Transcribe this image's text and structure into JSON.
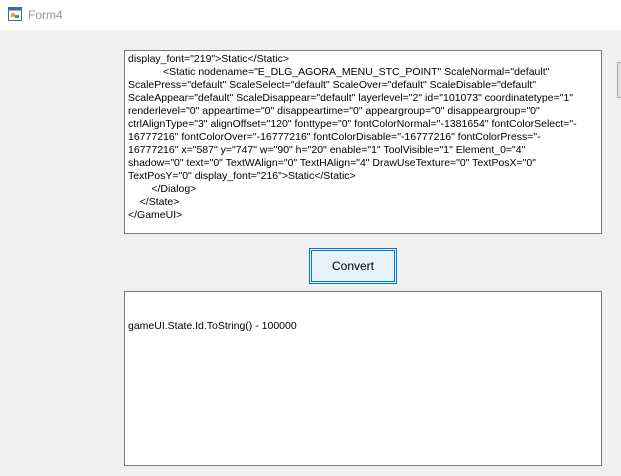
{
  "window": {
    "title": "Form4"
  },
  "source": {
    "lines": [
      "display_font=\"219\">Static</Static>",
      "            <Static nodename=\"E_DLG_AGORA_MENU_STC_POINT\" ScaleNormal=\"default\"",
      "ScalePress=\"default\" ScaleSelect=\"default\" ScaleOver=\"default\" ScaleDisable=\"default\"",
      "ScaleAppear=\"default\" ScaleDisappear=\"default\" layerlevel=\"2\" id=\"101073\" coordinatetype=\"1\"",
      "renderlevel=\"0\" appeartime=\"0\" disappeartime=\"0\" appeargroup=\"0\" disappeargroup=\"0\"",
      "ctrlAlignType=\"3\" alignOffset=\"120\" fonttype=\"0\" fontColorNormal=\"-1381654\" fontColorSelect=\"-",
      "16777216\" fontColorOver=\"-16777216\" fontColorDisable=\"-16777216\" fontColorPress=\"-",
      "16777216\" x=\"587\" y=\"747\" w=\"90\" h=\"20\" enable=\"1\" ToolVisible=\"1\" Element_0=\"4\"",
      "shadow=\"0\" text=\"0\" TextWAlign=\"0\" TextHAlign=\"4\" DrawUseTexture=\"0\" TextPosX=\"0\"",
      "TextPosY=\"0\" display_font=\"216\">Static</Static>",
      "        </Dialog>",
      "    </State>",
      "</GameUI>"
    ]
  },
  "convert_button": {
    "label": "Convert"
  },
  "output": {
    "text": "gameUI.State.Id.ToString() - 100000"
  }
}
